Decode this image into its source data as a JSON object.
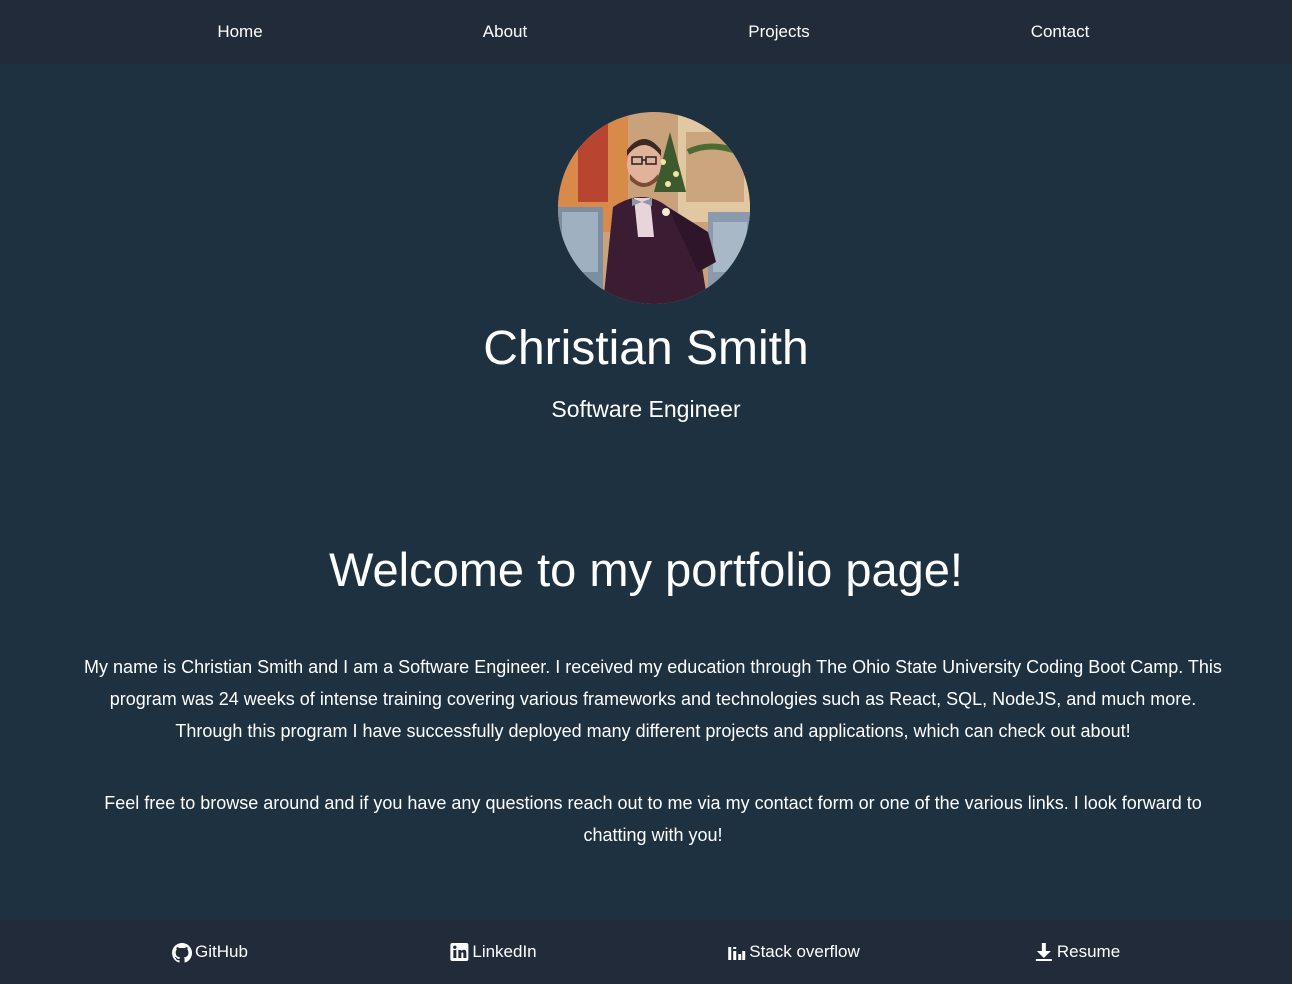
{
  "nav": {
    "items": [
      {
        "label": "Home"
      },
      {
        "label": "About"
      },
      {
        "label": "Projects"
      },
      {
        "label": "Contact"
      }
    ]
  },
  "hero": {
    "name": "Christian Smith",
    "role": "Software Engineer"
  },
  "main": {
    "heading": "Welcome to my portfolio page!",
    "paragraphs": [
      "My name is Christian Smith and I am a Software Engineer. I received my education through The Ohio State University Coding Boot Camp. This program was 24 weeks of intense training covering various frameworks and technologies such as React, SQL, NodeJS, and much more. Through this program I have successfully deployed many different projects and applications, which can check out about!",
      "Feel free to browse around and if you have any questions reach out to me via my contact form or one of the various links. I look forward to chatting with you!"
    ]
  },
  "footer": {
    "links": [
      {
        "label": "GitHub",
        "icon": "github-icon"
      },
      {
        "label": "LinkedIn",
        "icon": "linkedin-icon"
      },
      {
        "label": "Stack overflow",
        "icon": "stack-overflow-icon"
      },
      {
        "label": "Resume",
        "icon": "download-icon"
      }
    ]
  },
  "colors": {
    "background": "#1e3140",
    "bar": "#222b3a",
    "text": "#ffffff"
  }
}
